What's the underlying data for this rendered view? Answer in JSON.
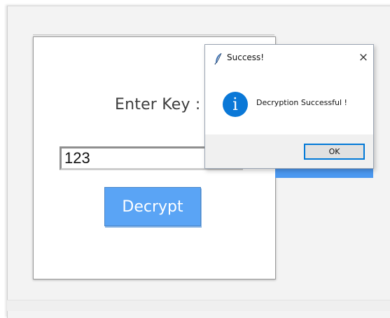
{
  "app": {
    "key_label": "Enter Key :",
    "key_value": "123",
    "decrypt_label": "Decrypt"
  },
  "dialog": {
    "title": "Success!",
    "close_symbol": "×",
    "info_symbol": "i",
    "message": "Decryption Successful !",
    "ok_label": "OK",
    "icons": [
      "feather-icon",
      "info-icon",
      "close-icon"
    ]
  },
  "colors": {
    "accent_button": "#5aa4f5",
    "info_icon": "#0a78d7",
    "ok_focus_border": "#0078d7"
  }
}
